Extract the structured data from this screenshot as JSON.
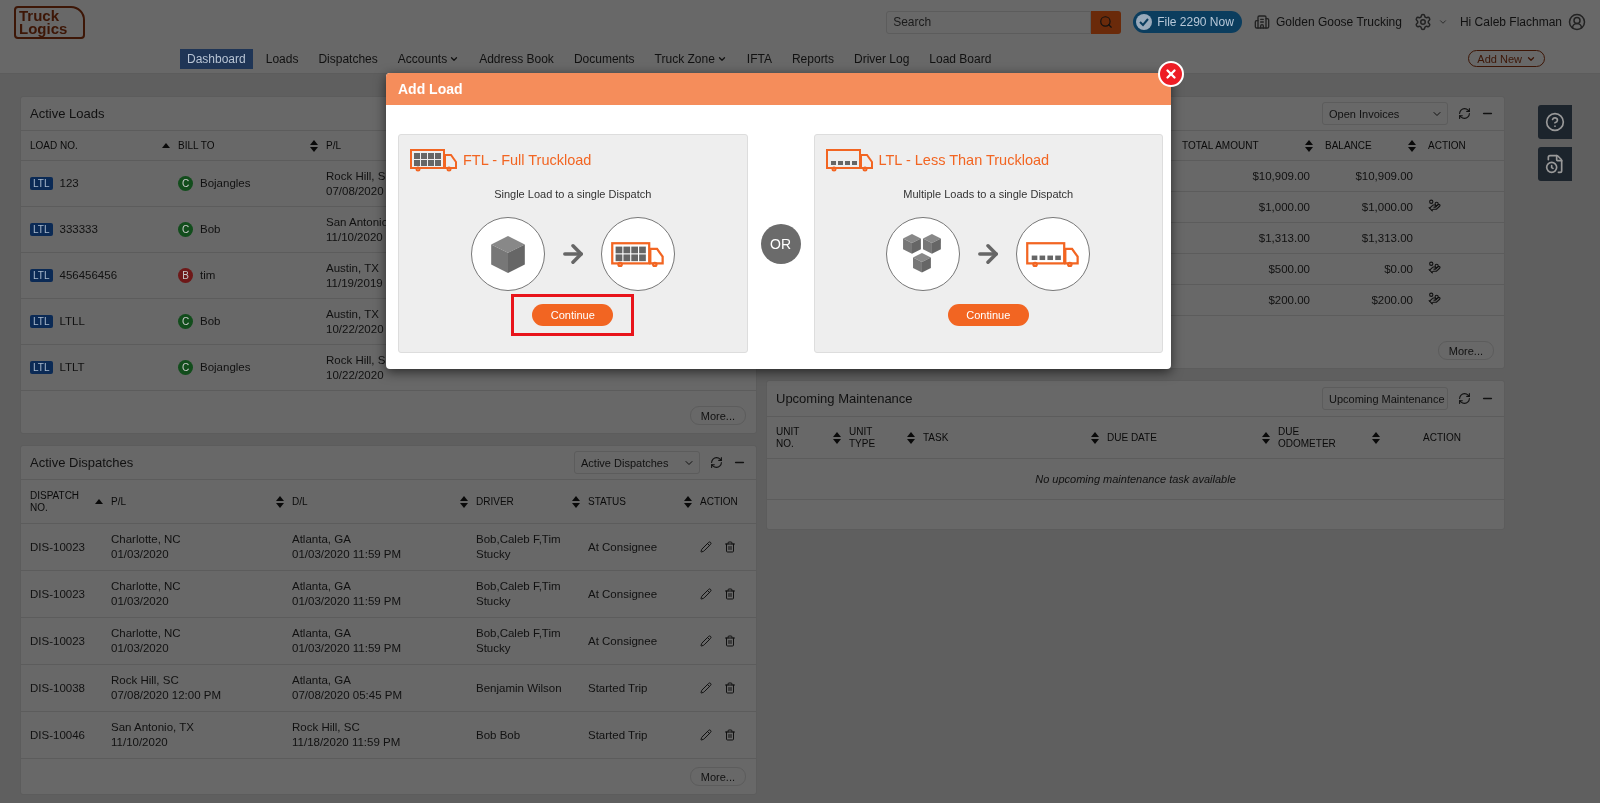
{
  "header": {
    "logo": {
      "line1": "Truck",
      "line2": "Logics"
    },
    "search": {
      "placeholder": "Search"
    },
    "file_button": "File 2290 Now",
    "company": "Golden Goose Trucking",
    "greeting": "Hi Caleb Flachman"
  },
  "nav": {
    "items": [
      {
        "label": "Dashboard",
        "selected": true,
        "dropdown": false
      },
      {
        "label": "Loads",
        "selected": false,
        "dropdown": false
      },
      {
        "label": "Dispatches",
        "selected": false,
        "dropdown": false
      },
      {
        "label": "Accounts",
        "selected": false,
        "dropdown": true
      },
      {
        "label": "Address Book",
        "selected": false,
        "dropdown": false
      },
      {
        "label": "Documents",
        "selected": false,
        "dropdown": false
      },
      {
        "label": "Truck Zone",
        "selected": false,
        "dropdown": true
      },
      {
        "label": "IFTA",
        "selected": false,
        "dropdown": false
      },
      {
        "label": "Reports",
        "selected": false,
        "dropdown": false
      },
      {
        "label": "Driver Log",
        "selected": false,
        "dropdown": false
      },
      {
        "label": "Load Board",
        "selected": false,
        "dropdown": false
      }
    ],
    "add_button": "Add New"
  },
  "active_loads": {
    "title": "Active Loads",
    "columns": [
      {
        "label": "LOAD NO.",
        "sortable": true,
        "sorted": true
      },
      {
        "label": "BILL TO",
        "sortable": true,
        "sorted": false
      },
      {
        "label": "P/L",
        "sortable": false
      }
    ],
    "rows": [
      {
        "type": "LTL",
        "load_no": "123",
        "bill_to": {
          "initial": "C",
          "color": "#124d1c",
          "name": "Bojangles"
        },
        "pickup": [
          "Rock Hill, S",
          "07/08/2020"
        ]
      },
      {
        "type": "LTL",
        "load_no": "333333",
        "bill_to": {
          "initial": "C",
          "color": "#124d1c",
          "name": "Bob"
        },
        "pickup": [
          "San Antonio",
          "11/10/2020"
        ]
      },
      {
        "type": "LTL",
        "load_no": "456456456",
        "bill_to": {
          "initial": "B",
          "color": "#6e1818",
          "name": "tim"
        },
        "pickup": [
          "Austin, TX",
          "11/19/2019"
        ]
      },
      {
        "type": "LTL",
        "load_no": "LTLL",
        "bill_to": {
          "initial": "C",
          "color": "#124d1c",
          "name": "Bob"
        },
        "pickup": [
          "Austin, TX",
          "10/22/2020"
        ]
      },
      {
        "type": "LTL",
        "load_no": "LTLT",
        "bill_to": {
          "initial": "C",
          "color": "#124d1c",
          "name": "Bojangles"
        },
        "pickup": [
          "Rock Hill, S",
          "10/22/2020"
        ]
      }
    ],
    "more": "More..."
  },
  "invoices": {
    "filter": "Open Invoices",
    "columns": [
      {
        "label": "TOTAL AMOUNT",
        "sortable": true,
        "sorted": false
      },
      {
        "label": "BALANCE",
        "sortable": true,
        "sorted": false
      },
      {
        "label": "ACTION",
        "sortable": false
      }
    ],
    "rows": [
      {
        "total": "$10,909.00",
        "balance": "$10,909.00",
        "payment_action": false
      },
      {
        "total": "$1,000.00",
        "balance": "$1,000.00",
        "payment_action": true
      },
      {
        "total": "$1,313.00",
        "balance": "$1,313.00",
        "payment_action": false
      },
      {
        "total": "$500.00",
        "balance": "$0.00",
        "payment_action": true
      },
      {
        "total": "$200.00",
        "balance": "$200.00",
        "payment_action": true
      }
    ],
    "more": "More..."
  },
  "active_dispatches": {
    "title": "Active Dispatches",
    "filter": "Active Dispatches",
    "columns": [
      {
        "label": "DISPATCH NO.",
        "sortable": true,
        "sorted": true
      },
      {
        "label": "P/L",
        "sortable": true,
        "sorted": false
      },
      {
        "label": "D/L",
        "sortable": true,
        "sorted": false
      },
      {
        "label": "DRIVER",
        "sortable": true,
        "sorted": false
      },
      {
        "label": "STATUS",
        "sortable": true,
        "sorted": false
      },
      {
        "label": "ACTION",
        "sortable": false
      }
    ],
    "rows": [
      {
        "dispatch_no": "DIS-10023",
        "pickup": [
          "Charlotte, NC",
          "01/03/2020"
        ],
        "delivery": [
          "Atlanta, GA",
          "01/03/2020 11:59 PM"
        ],
        "driver": "Bob,Caleb F,Tim Stucky",
        "status": "At Consignee"
      },
      {
        "dispatch_no": "DIS-10023",
        "pickup": [
          "Charlotte, NC",
          "01/03/2020"
        ],
        "delivery": [
          "Atlanta, GA",
          "01/03/2020 11:59 PM"
        ],
        "driver": "Bob,Caleb F,Tim Stucky",
        "status": "At Consignee"
      },
      {
        "dispatch_no": "DIS-10023",
        "pickup": [
          "Charlotte, NC",
          "01/03/2020"
        ],
        "delivery": [
          "Atlanta, GA",
          "01/03/2020 11:59 PM"
        ],
        "driver": "Bob,Caleb F,Tim Stucky",
        "status": "At Consignee"
      },
      {
        "dispatch_no": "DIS-10038",
        "pickup": [
          "Rock Hill, SC",
          "07/08/2020 12:00 PM"
        ],
        "delivery": [
          "Atlanta, GA",
          "07/08/2020 05:45 PM"
        ],
        "driver": "Benjamin Wilson",
        "status": "Started Trip"
      },
      {
        "dispatch_no": "DIS-10046",
        "pickup": [
          "San Antonio, TX",
          "11/10/2020"
        ],
        "delivery": [
          "Rock Hill, SC",
          "11/18/2020 11:59 PM"
        ],
        "driver": "Bob Bob",
        "status": "Started Trip"
      }
    ],
    "more": "More..."
  },
  "maintenance": {
    "title": "Upcoming Maintenance",
    "filter": "Upcoming Maintenance",
    "columns": [
      {
        "label": "UNIT NO.",
        "sortable": true,
        "sorted": false
      },
      {
        "label": "UNIT TYPE",
        "sortable": true,
        "sorted": false
      },
      {
        "label": "TASK",
        "sortable": true,
        "sorted": false
      },
      {
        "label": "DUE DATE",
        "sortable": true,
        "sorted": false
      },
      {
        "label": "DUE ODOMETER",
        "sortable": true,
        "sorted": false
      },
      {
        "label": "ACTION",
        "sortable": false
      }
    ],
    "empty_message": "No upcoming maintenance task available"
  },
  "modal": {
    "title": "Add Load",
    "separator": "OR",
    "options": [
      {
        "kind": "ftl",
        "title": "FTL - Full Truckload",
        "subtitle": "Single Load to a single Dispatch",
        "button": "Continue",
        "highlighted": true
      },
      {
        "kind": "ltl",
        "title": "LTL - Less Than Truckload",
        "subtitle": "Multiple Loads to a single Dispatch",
        "button": "Continue",
        "highlighted": false
      }
    ]
  }
}
